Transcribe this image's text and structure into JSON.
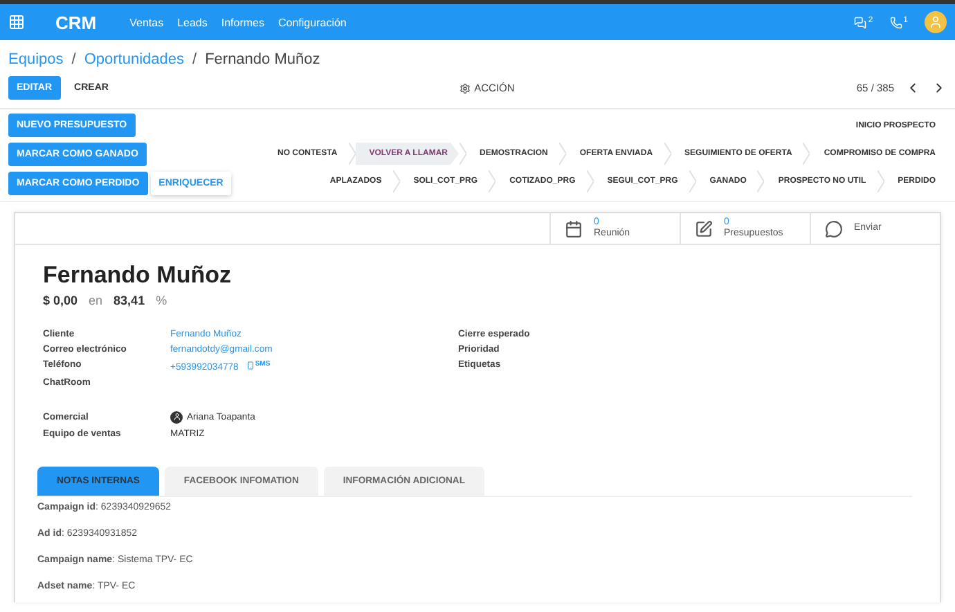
{
  "topbar": {
    "app": "CRM",
    "menu": [
      "Ventas",
      "Leads",
      "Informes",
      "Configuración"
    ],
    "messages_count": "2",
    "activities_count": "1"
  },
  "breadcrumb": {
    "separator": "/",
    "items": [
      {
        "label": "Equipos",
        "link": true
      },
      {
        "label": "Oportunidades",
        "link": true
      },
      {
        "label": "Fernando Muñoz",
        "link": false
      }
    ]
  },
  "control_panel": {
    "edit": "EDITAR",
    "create": "CREAR",
    "action": "ACCIÓN",
    "pager": "65 / 385"
  },
  "header_buttons": [
    {
      "label": "NUEVO PRESUPUESTO",
      "kind": "primary"
    },
    {
      "label": "MARCAR COMO GANADO",
      "kind": "primary"
    },
    {
      "label": "MARCAR COMO PERDIDO",
      "kind": "primary"
    },
    {
      "label": "ENRIQUECER",
      "kind": "secondary"
    }
  ],
  "stages": [
    [
      {
        "label": "INICIO PROSPECTO",
        "selected": false
      }
    ],
    [
      {
        "label": "NO CONTESTA",
        "selected": false
      },
      {
        "label": "VOLVER A LLAMAR",
        "selected": true
      },
      {
        "label": "DEMOSTRACION",
        "selected": false
      },
      {
        "label": "OFERTA ENVIADA",
        "selected": false
      },
      {
        "label": "SEGUIMIENTO DE OFERTA",
        "selected": false
      },
      {
        "label": "COMPROMISO DE COMPRA",
        "selected": false
      }
    ],
    [
      {
        "label": "APLAZADOS",
        "selected": false
      },
      {
        "label": "SOLI_COT_PRG",
        "selected": false
      },
      {
        "label": "COTIZADO_PRG",
        "selected": false
      },
      {
        "label": "SEGUI_COT_PRG",
        "selected": false
      },
      {
        "label": "GANADO",
        "selected": false
      },
      {
        "label": "PROSPECTO NO UTIL",
        "selected": false
      },
      {
        "label": "PERDIDO",
        "selected": false
      }
    ]
  ],
  "smart_buttons": [
    {
      "kind": "meeting",
      "count": "0",
      "label": "Reunión"
    },
    {
      "kind": "quote",
      "count": "0",
      "label": "Presupuestos"
    },
    {
      "kind": "whatsapp",
      "label": "Enviar"
    }
  ],
  "record": {
    "title": "Fernando Muñoz",
    "revenue": "$ 0,00",
    "at": "en",
    "probability": "83,41",
    "percent": "%"
  },
  "fields_left": [
    {
      "label": "Cliente",
      "value": "Fernando Muñoz",
      "kind": "link"
    },
    {
      "label": "Correo electrónico",
      "value": "fernandotdy@gmail.com",
      "kind": "link"
    },
    {
      "label": "Teléfono",
      "value": "+593992034778",
      "kind": "phone",
      "sms": "SMS"
    },
    {
      "label": "ChatRoom",
      "kind": "empty"
    }
  ],
  "fields_right": [
    {
      "label": "Cierre esperado"
    },
    {
      "label": "Prioridad"
    },
    {
      "label": "Etiquetas"
    }
  ],
  "fields_sales": [
    {
      "label": "Comercial",
      "value": "Ariana Toapanta",
      "kind": "user"
    },
    {
      "label": "Equipo de ventas",
      "value": "MATRIZ",
      "kind": "text"
    }
  ],
  "tabs": [
    {
      "label": "NOTAS INTERNAS",
      "selected": true
    },
    {
      "label": "FACEBOOK INFOMATION",
      "selected": false
    },
    {
      "label": "INFORMACIÓN ADICIONAL",
      "selected": false
    }
  ],
  "notes": [
    "**Campaign id**: 6239340929652",
    "**Ad id**: 6239340931852",
    "**Campaign name**: Sistema TPV- EC",
    "**Adset name**: TPV- EC"
  ]
}
